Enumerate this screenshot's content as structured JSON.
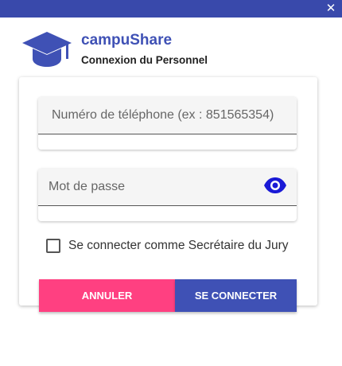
{
  "window": {
    "close_label": "✕"
  },
  "header": {
    "brand": "campuShare",
    "subtitle": "Connexion du Personnel",
    "logo_icon": "graduation-cap-icon"
  },
  "form": {
    "phone": {
      "placeholder": "Numéro de téléphone (ex : 851565354)",
      "value": ""
    },
    "password": {
      "placeholder": "Mot de passe",
      "value": "",
      "toggle_icon": "eye-icon"
    },
    "jury_checkbox": {
      "label": "Se connecter comme Secrétaire du Jury",
      "checked": false
    },
    "cancel_label": "ANNULER",
    "submit_label": "SE CONNECTER"
  },
  "colors": {
    "topbar": "#3949ab",
    "brand": "#3f51b5",
    "cancel": "#ff4081",
    "submit": "#3f51b5",
    "eye": "#1a1ad6"
  }
}
